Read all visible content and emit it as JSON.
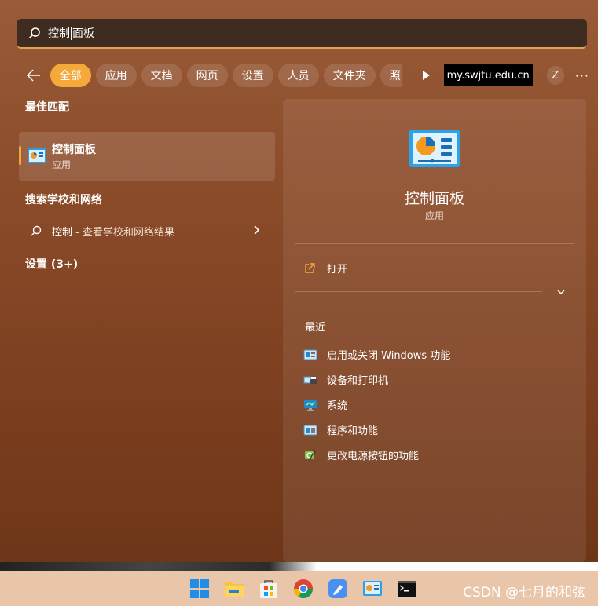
{
  "search": {
    "query_before_caret": "控制",
    "query_after_caret": "面板"
  },
  "filters": {
    "items": [
      "全部",
      "应用",
      "文档",
      "网页",
      "设置",
      "人员",
      "文件夹",
      "照"
    ],
    "active": "全部",
    "account_url": "my.swjtu.edu.cn",
    "avatar_letter": "Z"
  },
  "best_match": {
    "section_title": "最佳匹配",
    "app_name": "控制面板",
    "app_kind": "应用"
  },
  "web_search": {
    "section_title": "搜索学校和网络",
    "query": "控制",
    "suffix": " - 查看学校和网络结果"
  },
  "settings": {
    "section_title": "设置 (3+)"
  },
  "detail": {
    "title": "控制面板",
    "kind": "应用",
    "open_label": "打开",
    "recent_title": "最近",
    "recent": [
      "启用或关闭 Windows 功能",
      "设备和打印机",
      "系统",
      "程序和功能",
      "更改电源按钮的功能"
    ]
  },
  "taskbar": {
    "icons": [
      "windows-start-icon",
      "file-explorer-icon",
      "microsoft-store-icon",
      "chrome-icon",
      "pen-app-icon",
      "control-panel-icon",
      "terminal-icon"
    ],
    "watermark": "CSDN @七月的和弦"
  },
  "colors": {
    "accent": "#f5a93a",
    "url_badge_bg": "#000000"
  }
}
